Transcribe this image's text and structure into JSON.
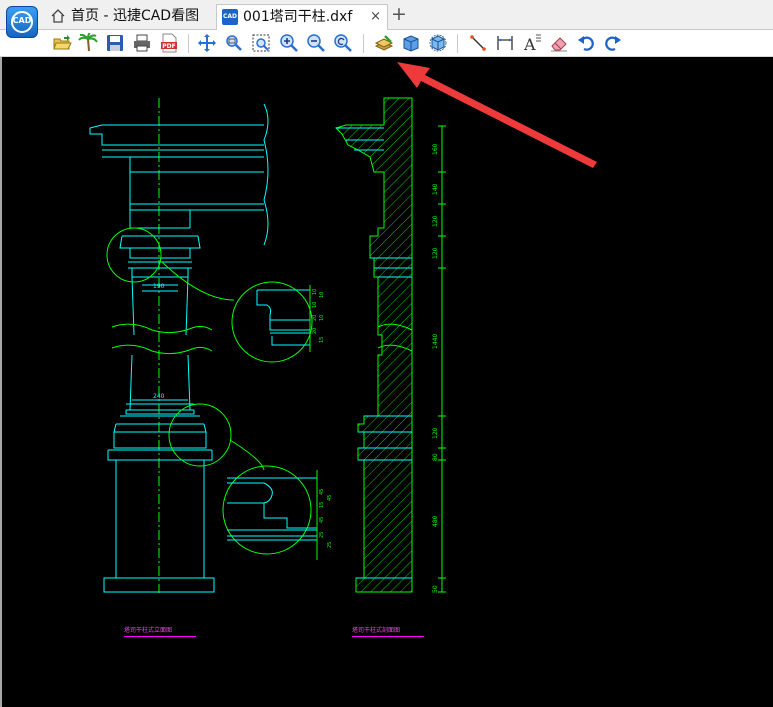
{
  "app": {
    "logo_text": "CAD"
  },
  "tabs": [
    {
      "label": "首页 - 迅捷CAD看图",
      "active": false
    },
    {
      "label": "001塔司干柱.dxf",
      "active": true
    }
  ],
  "tab_close": "×",
  "new_tab": "+",
  "toolbar": {
    "items": [
      "open-icon",
      "palm-tree-icon",
      "save-icon",
      "print-icon",
      "pdf-icon",
      "pan-icon",
      "zoom-window-icon",
      "zoom-extents-icon",
      "zoom-in-icon",
      "zoom-out-icon",
      "zoom-previous-icon",
      "layer-icon",
      "3d-box-icon",
      "3d-orbit-icon",
      "measure-length-icon",
      "measure-dim-icon",
      "text-icon",
      "eraser-icon",
      "undo-icon",
      "redo-icon"
    ],
    "pdf_badge": "PDF",
    "text_glyph": "A"
  },
  "drawing": {
    "left_caption": "塔司干柱式立面图",
    "right_caption": "塔司干柱式剖面图",
    "dim_190": "190",
    "dim_240": "240",
    "right_dims": [
      "160",
      "140",
      "120",
      "120",
      "1440",
      "120",
      "80",
      "480",
      "50"
    ],
    "detail_top_dims": [
      "10",
      "10",
      "20",
      "20",
      "10",
      "10",
      "15"
    ],
    "detail_bottom_dims": [
      "45",
      "15",
      "45",
      "25",
      "45",
      "25"
    ]
  },
  "colors": {
    "accent": "#1e63c8",
    "cad_cyan": "#00ffff",
    "cad_green": "#00ff00",
    "cad_magenta": "#ff00ff",
    "arrow_red": "#ee3a3a"
  }
}
